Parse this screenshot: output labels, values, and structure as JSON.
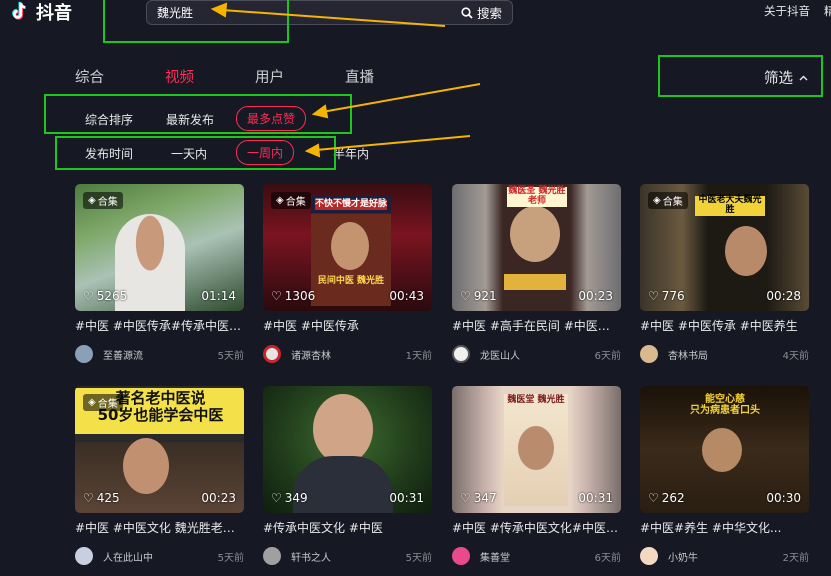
{
  "header": {
    "brand": "抖音",
    "search_value": "魏光胜",
    "search_button": "搜索",
    "about_link": "关于抖音",
    "more_link": "精"
  },
  "tabs": [
    {
      "label": "综合",
      "active": false
    },
    {
      "label": "视频",
      "active": true
    },
    {
      "label": "用户",
      "active": false
    },
    {
      "label": "直播",
      "active": false
    }
  ],
  "filter_label": "筛选",
  "sort": {
    "options": [
      "综合排序",
      "最新发布",
      "最多点赞"
    ],
    "selected": "最多点赞"
  },
  "publish_time": {
    "label": "发布时间",
    "options": [
      "一天内",
      "一周内",
      "半年内"
    ],
    "selected": "一周内"
  },
  "collection_badge": "合集",
  "videos": [
    {
      "likes": "5265",
      "duration": "01:14",
      "desc": "#中医 #中医传承#传承中医文...",
      "author": "至善源流",
      "time": "5天前",
      "collection": true,
      "overlay": ""
    },
    {
      "likes": "1306",
      "duration": "00:43",
      "desc": "#中医 #中医传承",
      "author": "诸源杏林",
      "time": "1天前",
      "collection": true,
      "overlay": "不快不慢才是好脉 民间中医 魏光胜"
    },
    {
      "likes": "921",
      "duration": "00:23",
      "desc": "#中医 #高手在民间 #中医传承",
      "author": "龙医山人",
      "time": "6天前",
      "collection": false,
      "overlay": "魏医圣 魏光胜老师"
    },
    {
      "likes": "776",
      "duration": "00:28",
      "desc": "#中医 #中医传承 #中医养生",
      "author": "杏林书局",
      "time": "4天前",
      "collection": true,
      "overlay": "中医老大夫魏光胜"
    },
    {
      "likes": "425",
      "duration": "00:23",
      "desc": "#中医 #中医文化 魏光胜老中...",
      "author": "人在此山中",
      "time": "5天前",
      "collection": true,
      "overlay": "著名老中医说 50岁也能学会中医"
    },
    {
      "likes": "349",
      "duration": "00:31",
      "desc": "#传承中医文化 #中医",
      "author": "轩书之人",
      "time": "5天前",
      "collection": false,
      "overlay": ""
    },
    {
      "likes": "347",
      "duration": "00:31",
      "desc": "#中医 #传承中医文化#中医传...",
      "author": "集善堂",
      "time": "6天前",
      "collection": false,
      "overlay": "魏医堂 魏光胜"
    },
    {
      "likes": "262",
      "duration": "00:30",
      "desc": "#中医#养生 #中华文化...",
      "author": "小奶牛",
      "time": "2天前",
      "collection": false,
      "overlay": "能空心慈 只为病患者口头"
    }
  ],
  "colors": {
    "accent": "#fe2c55",
    "annotation": "#1fc51f",
    "arrow": "#f5b400",
    "background": "#161823"
  }
}
